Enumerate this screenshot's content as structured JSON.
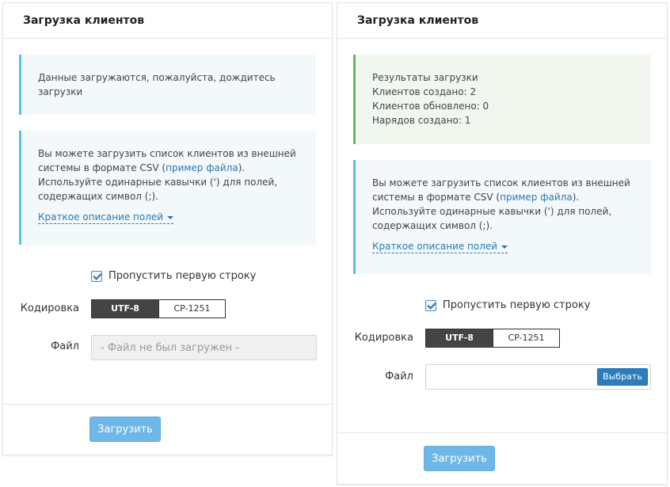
{
  "left": {
    "title": "Загрузка клиентов",
    "status_lines": [
      "Данные загружаются, пожалуйста, дождитесь",
      "загрузки"
    ],
    "info": {
      "line1": "Вы можете загрузить список клиентов из внешней",
      "line2_before": "системы в формате CSV (",
      "link": "пример файла",
      "line2_after": ").",
      "line3": "Используйте одинарные кавычки (') для полей,",
      "line4": "содержащих символ (;).",
      "toggle": "Краткое описание полей"
    },
    "skip_first_row": "Пропустить первую строку",
    "encoding_label": "Кодировка",
    "encoding_options": [
      "UTF-8",
      "CP-1251"
    ],
    "file_label": "Файл",
    "file_placeholder": "- Файл не был загружен -",
    "submit": "Загрузить"
  },
  "right": {
    "title": "Загрузка клиентов",
    "result_lines": [
      "Результаты загрузки",
      "Клиентов создано: 2",
      "Клиентов обновлено: 0",
      "Нарядов создано: 1"
    ],
    "info": {
      "line1": "Вы можете загрузить список клиентов из внешней",
      "line2_before": "системы в формате CSV (",
      "link": "пример файла",
      "line2_after": ").",
      "line3": "Используйте одинарные кавычки (') для полей,",
      "line4": "содержащих символ (;).",
      "toggle": "Краткое описание полей"
    },
    "skip_first_row": "Пропустить первую строку",
    "encoding_label": "Кодировка",
    "encoding_options": [
      "UTF-8",
      "CP-1251"
    ],
    "file_label": "Файл",
    "choose_button": "Выбрать",
    "submit": "Загрузить"
  },
  "colors": {
    "accent": "#2b7dbd",
    "info_border": "#5bc0de",
    "success_border": "#5cb85c",
    "submit": "#6fb7e8"
  },
  "icons": {
    "checkbox": "checkmark-icon",
    "toggle": "caret-down-icon"
  }
}
